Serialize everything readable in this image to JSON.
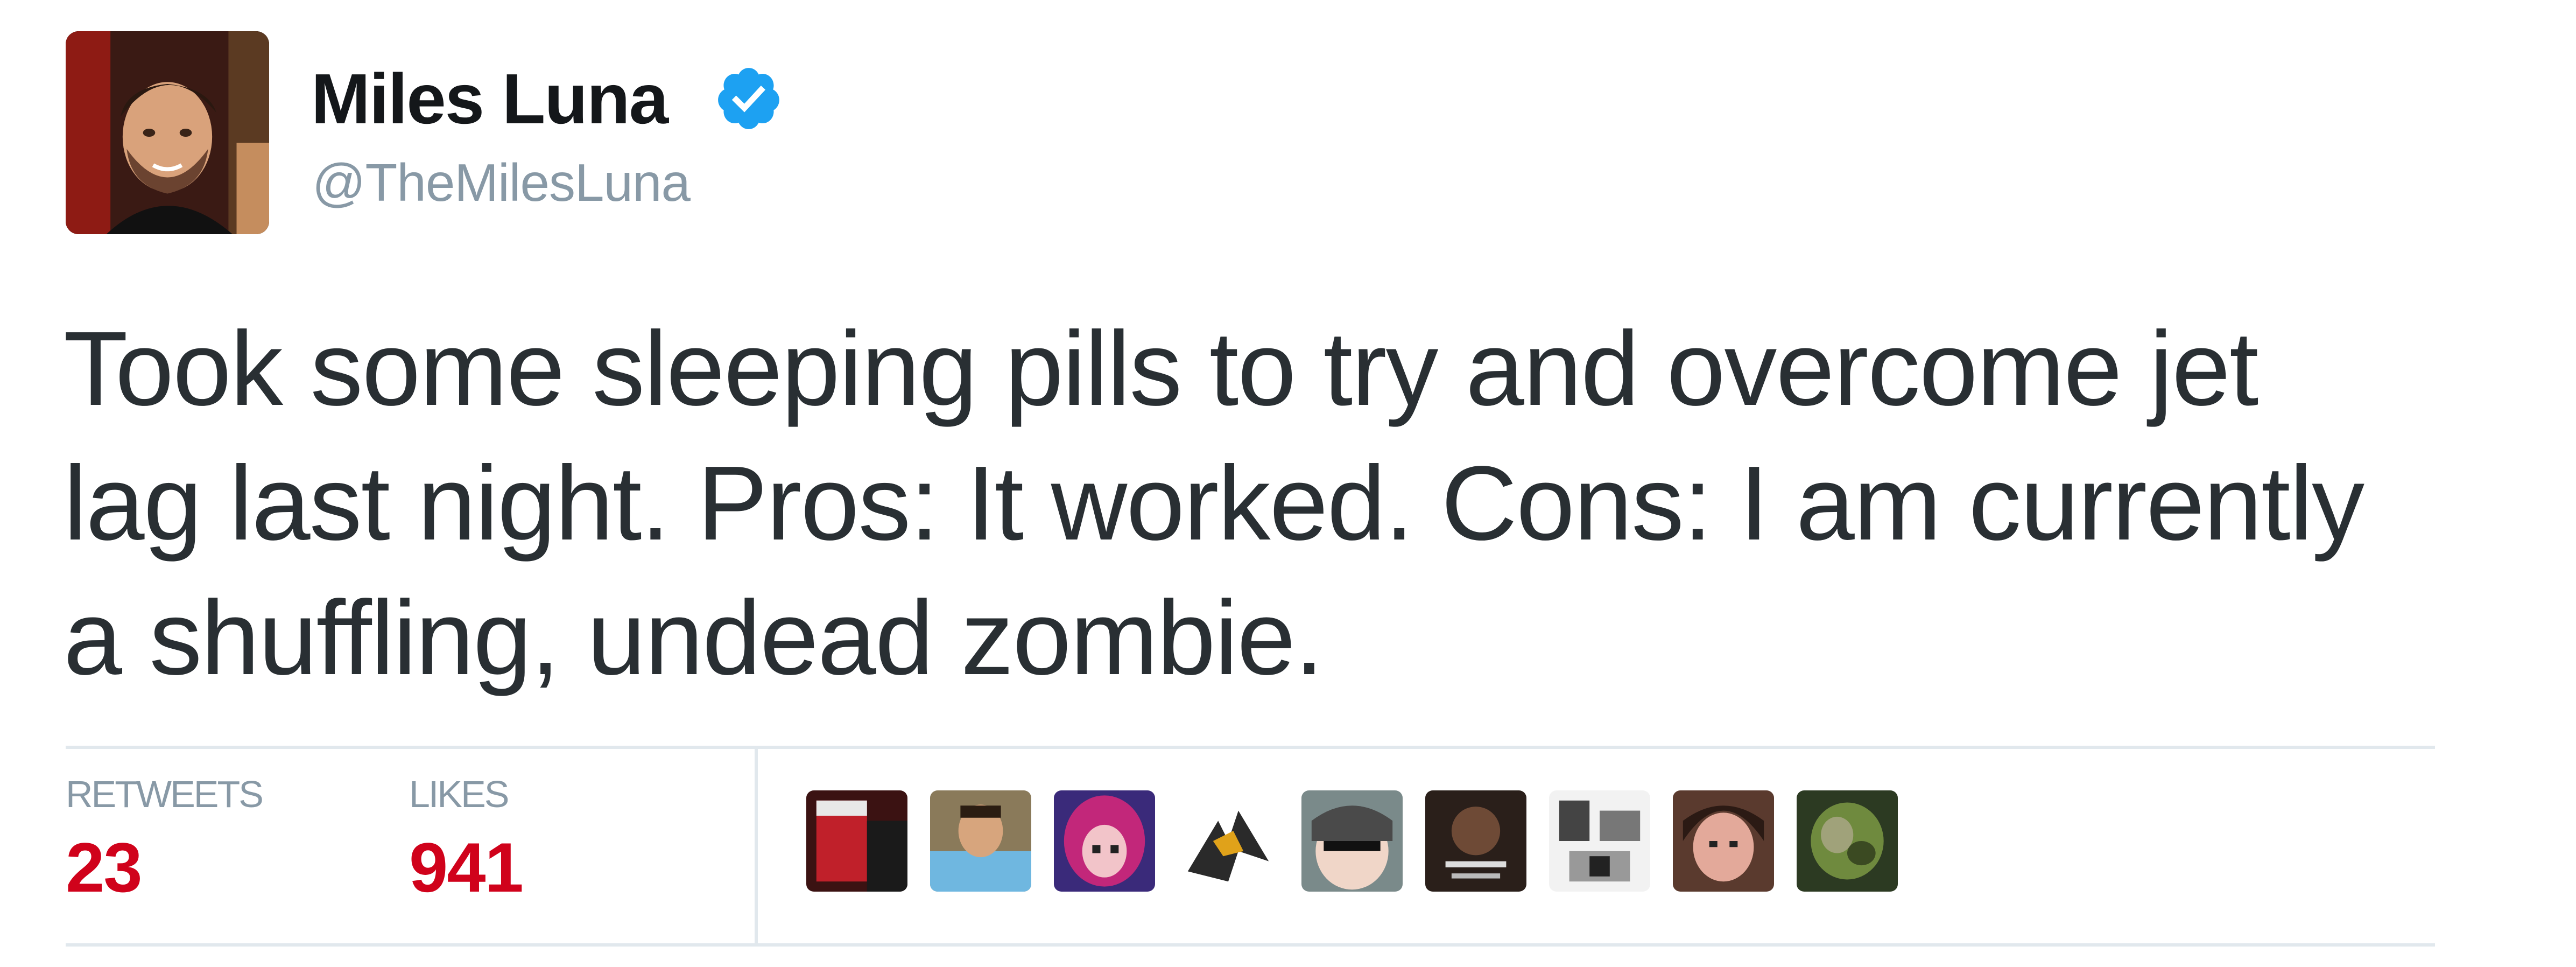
{
  "tweet": {
    "author": {
      "display_name": "Miles Luna",
      "handle": "@TheMilesLuna",
      "verified": true
    },
    "text_lines": [
      "Took some sleeping pills to try and overcome jet",
      "lag last night. Pros: It worked. Cons: I am currently",
      "a shuffling, undead zombie."
    ],
    "stats": {
      "retweets_label": "RETWEETS",
      "retweets_count": "23",
      "likes_label": "LIKES",
      "likes_count": "941"
    },
    "liker_avatar_count": 9
  },
  "colors": {
    "name": "#14171a",
    "handle": "#8899a6",
    "text": "#292f33",
    "stat_value": "#d0021b",
    "divider": "#e1e8ed",
    "verified_badge": "#1da1f2"
  },
  "icons": {
    "verified": "verified-badge-icon"
  }
}
